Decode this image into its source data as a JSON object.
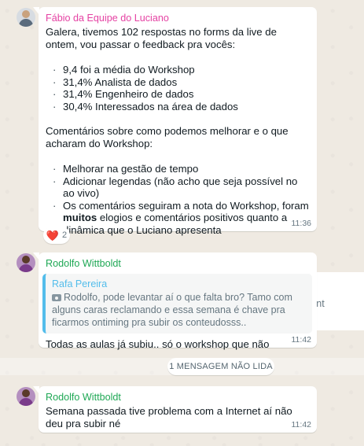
{
  "messages": [
    {
      "sender": "Fábio da Equipe do Luciano",
      "intro": "Galera, tivemos 102 respostas no forms da live de ontem, vou passar o feedback pra vocês:",
      "stats": [
        "9,4 foi a média do Workshop",
        "31,4% Analista de dados",
        "31,4% Engenheiro de dados",
        "30,4% Interessados na área de dados"
      ],
      "comments_intro": "Comentários sobre como podemos melhorar e o que acharam do Workshop:",
      "comments": [
        "Melhorar na gestão de tempo",
        "Adicionar legendas (não acho que seja possível no ao vivo)"
      ],
      "comment_bold_prefix": "Os comentários seguiram a nota do Workshop, foram ",
      "comment_bold": "muitos",
      "comment_bold_suffix": " elogios e comentários positivos quanto a dinâmica que o Luciano apresenta",
      "time": "11:36",
      "reaction": {
        "emoji": "❤️",
        "count": "2"
      }
    },
    {
      "sender": "Rodolfo Wittboldt",
      "quote": {
        "name": "Rafa Pereira",
        "text": "Rodolfo, pode levantar aí o que falta bro? Tamo com alguns caras reclamando e essa semana é chave pra ficarmos ontiming pra subir os conteudosss.."
      },
      "text": "Todas as aulas já subiu.. só o workshop que não",
      "time": "11:42",
      "cutoff_text": "pelo cont"
    },
    {
      "sender": "Rodolfo Wittboldt",
      "text": "Semana passada tive problema com a Internet aí não deu pra subir né",
      "time": "11:42"
    }
  ],
  "unread_banner": "1 MENSAGEM NÃO LIDA",
  "colors": {
    "sender_pink": "#e542a3",
    "sender_green": "#1fa855",
    "quote_accent": "#53bdeb",
    "background": "#efeae2"
  }
}
